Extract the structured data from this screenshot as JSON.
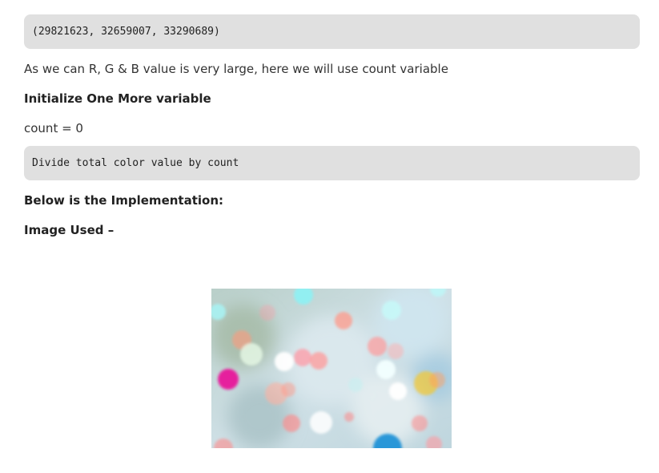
{
  "code_block_1": "(29821623, 32659007, 33290689)",
  "paragraph_1": "As we can R, G & B value is very large, here we will use count variable",
  "heading_initialize": "Initialize One More variable",
  "paragraph_count": "count = 0",
  "code_block_2": "Divide total color value by count",
  "heading_implementation": "Below is the Implementation:",
  "heading_image_used": "Image Used –",
  "image": {
    "subject": "blurred bokeh lights",
    "colors": {
      "background": "#c9dbe0",
      "cyan": "#8ff0f2",
      "pink": "#ff9a9a",
      "magenta": "#e8189a",
      "white": "#ffffff",
      "yellow": "#f2c83a",
      "blue": "#1a8fd6"
    }
  }
}
